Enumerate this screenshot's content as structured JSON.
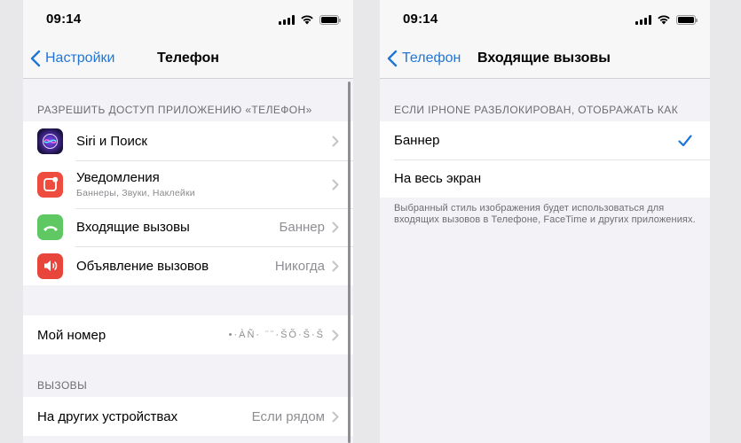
{
  "left_screen": {
    "status": {
      "time": "09:14"
    },
    "nav": {
      "back_label": "Настройки",
      "title": "Телефон"
    },
    "sections": {
      "access_header": "РАЗРЕШИТЬ ДОСТУП ПРИЛОЖЕНИЮ «ТЕЛЕФОН»",
      "calls_header": "ВЫЗОВЫ"
    },
    "access_items": [
      {
        "label": "Siri и Поиск",
        "value": "",
        "icon": "siri-icon"
      },
      {
        "label": "Уведомления",
        "subtitle": "Баннеры, Звуки, Наклейки",
        "value": "",
        "icon": "notifications-icon"
      },
      {
        "label": "Входящие вызовы",
        "value": "Баннер",
        "icon": "phone-icon"
      },
      {
        "label": "Объявление вызовов",
        "value": "Никогда",
        "icon": "speaker-icon"
      }
    ],
    "my_number": {
      "label": "Мой номер",
      "value": "•·ÀÑ· ¨¨·ŠÕ·Š·Š"
    },
    "calls_items": [
      {
        "label": "На других устройствах",
        "value": "Если рядом"
      }
    ]
  },
  "right_screen": {
    "status": {
      "time": "09:14"
    },
    "nav": {
      "back_label": "Телефон",
      "title": "Входящие вызовы"
    },
    "section_header": "ЕСЛИ IPHONE РАЗБЛОКИРОВАН, ОТОБРАЖАТЬ КАК",
    "options": [
      {
        "label": "Баннер",
        "selected": true
      },
      {
        "label": "На весь экран",
        "selected": false
      }
    ],
    "footer": "Выбранный стиль изображения будет использоваться для входящих вызовов в Телефоне, FaceTime и других приложениях."
  },
  "colors": {
    "accent": "#1f76d6",
    "siri": "#4a2a9a",
    "notifications": "#ee4c3f",
    "incoming_calls": "#60c863",
    "announce_calls": "#e8453b"
  }
}
